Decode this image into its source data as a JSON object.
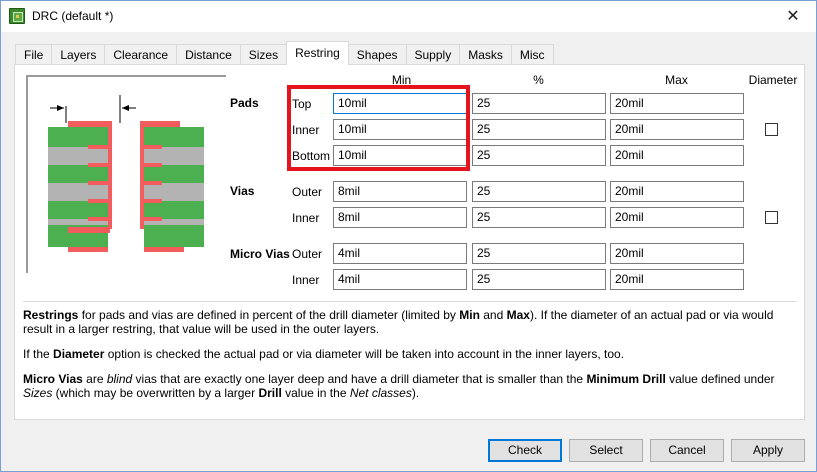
{
  "window": {
    "title": "DRC (default *)",
    "close_glyph": "✕"
  },
  "tabs": [
    {
      "label": "File"
    },
    {
      "label": "Layers"
    },
    {
      "label": "Clearance"
    },
    {
      "label": "Distance"
    },
    {
      "label": "Sizes"
    },
    {
      "label": "Restring"
    },
    {
      "label": "Shapes"
    },
    {
      "label": "Supply"
    },
    {
      "label": "Masks"
    },
    {
      "label": "Misc"
    }
  ],
  "active_tab": "Restring",
  "columns": {
    "min": "Min",
    "percent": "%",
    "max": "Max",
    "diameter": "Diameter"
  },
  "pads": {
    "label": "Pads",
    "top": {
      "label": "Top",
      "min": "10mil",
      "percent": "25",
      "max": "20mil"
    },
    "inner": {
      "label": "Inner",
      "min": "10mil",
      "percent": "25",
      "max": "20mil"
    },
    "bottom": {
      "label": "Bottom",
      "min": "10mil",
      "percent": "25",
      "max": "20mil"
    },
    "diameter_checked": false
  },
  "vias": {
    "label": "Vias",
    "outer": {
      "label": "Outer",
      "min": "8mil",
      "percent": "25",
      "max": "20mil"
    },
    "inner": {
      "label": "Inner",
      "min": "8mil",
      "percent": "25",
      "max": "20mil"
    },
    "diameter_checked": false
  },
  "micro_vias": {
    "label": "Micro Vias",
    "outer": {
      "label": "Outer",
      "min": "4mil",
      "percent": "25",
      "max": "20mil"
    },
    "inner": {
      "label": "Inner",
      "min": "4mil",
      "percent": "25",
      "max": "20mil"
    }
  },
  "help": {
    "p1": {
      "b1": "Restrings",
      "t1": " for pads and vias are defined in percent of the drill diameter (limited by ",
      "b2": "Min",
      "t2": " and ",
      "b3": "Max",
      "t3": "). If the diameter of an actual pad or via would result in a larger restring, that value will be used in the outer layers."
    },
    "p2": {
      "t1": "If the ",
      "b1": "Diameter",
      "t2": " option is checked the actual pad or via diameter will be taken into account in the inner layers, too."
    },
    "p3": {
      "b1": "Micro Vias",
      "t1": " are ",
      "i1": "blind",
      "t2": " vias that are exactly one layer deep and have a drill diameter that is smaller than the ",
      "b2": "Minimum Drill",
      "t3": " value defined under ",
      "i2": "Sizes",
      "t4": " (which may be overwritten by a larger ",
      "b3": "Drill",
      "t5": " value in the ",
      "i3": "Net classes",
      "t6": ")."
    }
  },
  "buttons": {
    "check": "Check",
    "select": "Select",
    "cancel": "Cancel",
    "apply": "Apply"
  },
  "colors": {
    "copper": "#4caf50",
    "restring": "#f25c5c",
    "substrate": "#b3b3b3",
    "highlight": "#e3141c",
    "focus": "#0078d7"
  }
}
